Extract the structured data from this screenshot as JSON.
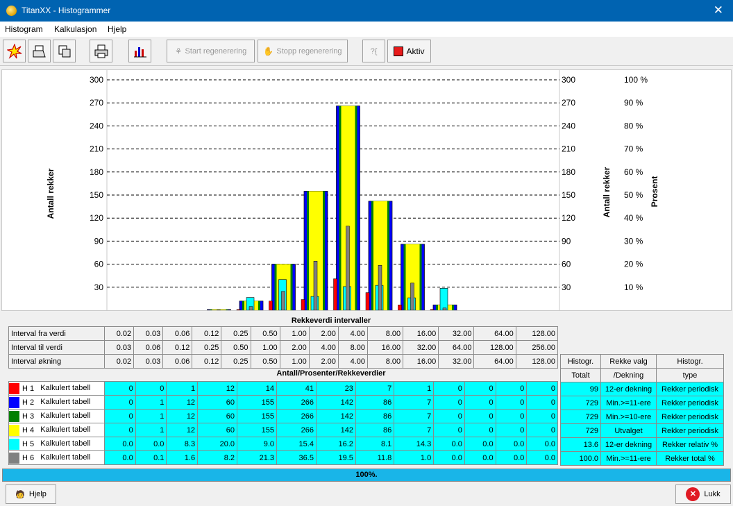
{
  "window": {
    "title": "TitanXX - Histogrammer",
    "close_icon": "close-icon"
  },
  "menu": [
    "Histogram",
    "Kalkulasjon",
    "Hjelp"
  ],
  "toolbar": {
    "start_label": "Start regenerering",
    "stop_label": "Stopp regenerering",
    "help_glyph": "?{",
    "aktiv_label": "Aktiv",
    "aktiv_color": "#e81b1b"
  },
  "chart_data": {
    "type": "bar",
    "ylabel_left": "Antall rekker",
    "ylabel_right": "Antall rekker",
    "ylabel_right2": "Prosent",
    "yticks": [
      30,
      60,
      90,
      120,
      150,
      180,
      210,
      240,
      270,
      300
    ],
    "percent_ticks": [
      "10 %",
      "20 %",
      "30 %",
      "40 %",
      "50 %",
      "60 %",
      "70 %",
      "80 %",
      "90 %",
      "100 %"
    ],
    "ylim": [
      0,
      300
    ],
    "grid": true,
    "categories": [
      "0.02-0.03",
      "0.03-0.06",
      "0.06-0.12",
      "0.12-0.25",
      "0.25-0.50",
      "0.50-1.00",
      "1.00-2.00",
      "2.00-4.00",
      "4.00-8.00",
      "8.00-16.00",
      "16.00-32.00",
      "32.00-64.00",
      "64.00-128.00",
      "128.00-256.00"
    ],
    "series": [
      {
        "name": "H 1",
        "color": "#ff0000",
        "values": [
          0,
          0,
          1,
          12,
          14,
          41,
          23,
          7,
          1,
          0,
          0,
          0,
          0,
          0
        ]
      },
      {
        "name": "H 2",
        "color": "#0000ff",
        "values": [
          0,
          1,
          12,
          60,
          155,
          266,
          142,
          86,
          7,
          0,
          0,
          0,
          0,
          0
        ]
      },
      {
        "name": "H 3",
        "color": "#008000",
        "values": [
          0,
          1,
          12,
          60,
          155,
          266,
          142,
          86,
          7,
          0,
          0,
          0,
          0,
          0
        ]
      },
      {
        "name": "H 4",
        "color": "#ffff00",
        "values": [
          0,
          1,
          12,
          60,
          155,
          266,
          142,
          86,
          7,
          0,
          0,
          0,
          0,
          0
        ]
      },
      {
        "name": "H 5",
        "color": "#00ffff",
        "values": [
          0.0,
          0.0,
          8.3,
          20.0,
          9.0,
          15.4,
          16.2,
          8.1,
          14.3,
          0.0,
          0.0,
          0.0,
          0.0,
          0.0
        ]
      },
      {
        "name": "H 6",
        "color": "#808080",
        "values": [
          0.0,
          0.1,
          1.6,
          8.2,
          21.3,
          36.5,
          19.5,
          11.8,
          1.0,
          0.0,
          0.0,
          0.0,
          0.0,
          0.0
        ]
      }
    ]
  },
  "table": {
    "intervals_header": "Rekkeverdi intervaller",
    "rows_header": "Antall/Prosenter/Rekkeverdier",
    "interval_rows": [
      {
        "label": "Interval fra verdi",
        "values": [
          "0.02",
          "0.03",
          "0.06",
          "0.12",
          "0.25",
          "0.50",
          "1.00",
          "2.00",
          "4.00",
          "8.00",
          "16.00",
          "32.00",
          "64.00",
          "128.00"
        ]
      },
      {
        "label": "Interval til verdi",
        "values": [
          "0.03",
          "0.06",
          "0.12",
          "0.25",
          "0.50",
          "1.00",
          "2.00",
          "4.00",
          "8.00",
          "16.00",
          "32.00",
          "64.00",
          "128.00",
          "256.00"
        ]
      },
      {
        "label": "Interval økning",
        "values": [
          "0.02",
          "0.03",
          "0.06",
          "0.12",
          "0.25",
          "0.50",
          "1.00",
          "2.00",
          "4.00",
          "8.00",
          "16.00",
          "32.00",
          "64.00",
          "128.00"
        ]
      }
    ],
    "data_rows": [
      {
        "id": "H 1",
        "name": "Kalkulert tabell",
        "color": "#ff0000",
        "values": [
          "0",
          "0",
          "1",
          "12",
          "14",
          "41",
          "23",
          "7",
          "1",
          "0",
          "0",
          "0",
          "0"
        ],
        "total": "99",
        "valg": "12-er dekning",
        "type": "Rekker periodisk"
      },
      {
        "id": "H 2",
        "name": "Kalkulert tabell",
        "color": "#0000ff",
        "values": [
          "0",
          "1",
          "12",
          "60",
          "155",
          "266",
          "142",
          "86",
          "7",
          "0",
          "0",
          "0",
          "0"
        ],
        "total": "729",
        "valg": "Min.>=11-ere",
        "type": "Rekker periodisk"
      },
      {
        "id": "H 3",
        "name": "Kalkulert tabell",
        "color": "#008000",
        "values": [
          "0",
          "1",
          "12",
          "60",
          "155",
          "266",
          "142",
          "86",
          "7",
          "0",
          "0",
          "0",
          "0"
        ],
        "total": "729",
        "valg": "Min.>=10-ere",
        "type": "Rekker periodisk"
      },
      {
        "id": "H 4",
        "name": "Kalkulert tabell",
        "color": "#ffff00",
        "values": [
          "0",
          "1",
          "12",
          "60",
          "155",
          "266",
          "142",
          "86",
          "7",
          "0",
          "0",
          "0",
          "0"
        ],
        "total": "729",
        "valg": "Utvalget",
        "type": "Rekker periodisk"
      },
      {
        "id": "H 5",
        "name": "Kalkulert tabell",
        "color": "#00ffff",
        "values": [
          "0.0",
          "0.0",
          "8.3",
          "20.0",
          "9.0",
          "15.4",
          "16.2",
          "8.1",
          "14.3",
          "0.0",
          "0.0",
          "0.0",
          "0.0"
        ],
        "total": "13.6",
        "valg": "12-er dekning",
        "type": "Rekker relativ %"
      },
      {
        "id": "H 6",
        "name": "Kalkulert tabell",
        "color": "#808080",
        "values": [
          "0.0",
          "0.1",
          "1.6",
          "8.2",
          "21.3",
          "36.5",
          "19.5",
          "11.8",
          "1.0",
          "0.0",
          "0.0",
          "0.0",
          "0.0"
        ],
        "total": "100.0",
        "valg": "Min.>=11-ere",
        "type": "Rekker total %"
      }
    ],
    "side_headers": {
      "histogr": "Histogr.",
      "rekke_valg": "Rekke valg",
      "histogr2": "Histogr.",
      "totalt": "Totalt",
      "dekning": "/Dekning",
      "type": "type"
    }
  },
  "progress": {
    "label": "100%.",
    "value": 1.0
  },
  "bottom": {
    "help_label": "Hjelp",
    "close_label": "Lukk"
  }
}
